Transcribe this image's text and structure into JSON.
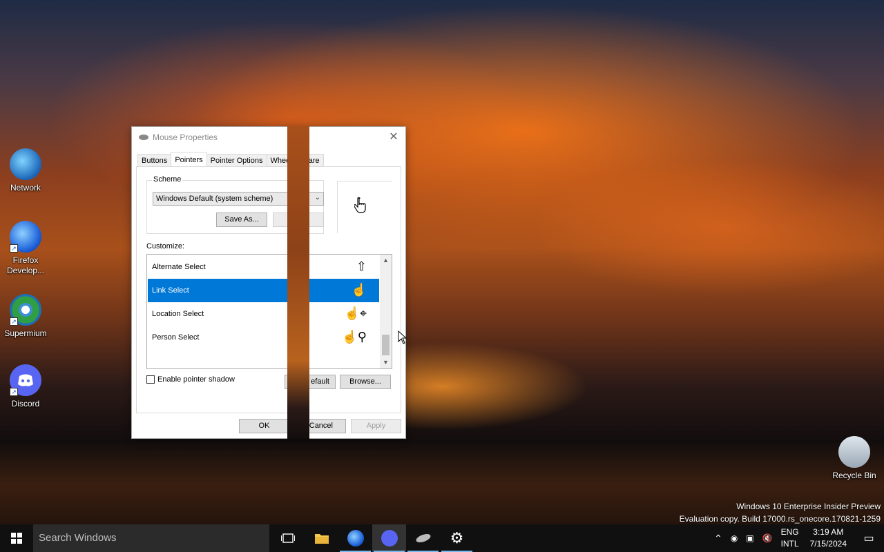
{
  "desktop": {
    "icons": [
      {
        "label": "Network"
      },
      {
        "label": "Firefox Develop..."
      },
      {
        "label": "Supermium"
      },
      {
        "label": "Discord"
      },
      {
        "label": "Recycle Bin"
      }
    ]
  },
  "dialog": {
    "title": "Mouse Properties",
    "tabs": [
      "Buttons",
      "Pointers",
      "Pointer Options",
      "Wheel",
      "dware"
    ],
    "active_tab": "Pointers",
    "scheme_label": "Scheme",
    "scheme_value": "Windows Default (system scheme)",
    "save_as_label": "Save As...",
    "customize_label": "Customize:",
    "list_items": [
      {
        "label": "Alternate Select",
        "selected": false
      },
      {
        "label": "Link Select",
        "selected": true
      },
      {
        "label": "Location Select",
        "selected": false
      },
      {
        "label": "Person Select",
        "selected": false
      }
    ],
    "enable_shadow_label": "Enable pointer shadow",
    "use_default_label": "efault",
    "browse_label": "Browse...",
    "ok_label": "OK",
    "cancel_label": "Cancel",
    "apply_label": "Apply"
  },
  "taskbar": {
    "search_placeholder": "Search Windows",
    "lang_top": "ENG",
    "lang_bottom": "INTL",
    "time": "3:19 AM",
    "date": "7/15/2024"
  },
  "watermark": {
    "line1": "Windows 10 Enterprise Insider Preview",
    "line2": "Evaluation copy. Build 17000.rs_onecore.170821-1259"
  },
  "colors": {
    "selection": "#0078d7",
    "taskbar": "#101010",
    "accent_underline": "#76b9ed"
  }
}
